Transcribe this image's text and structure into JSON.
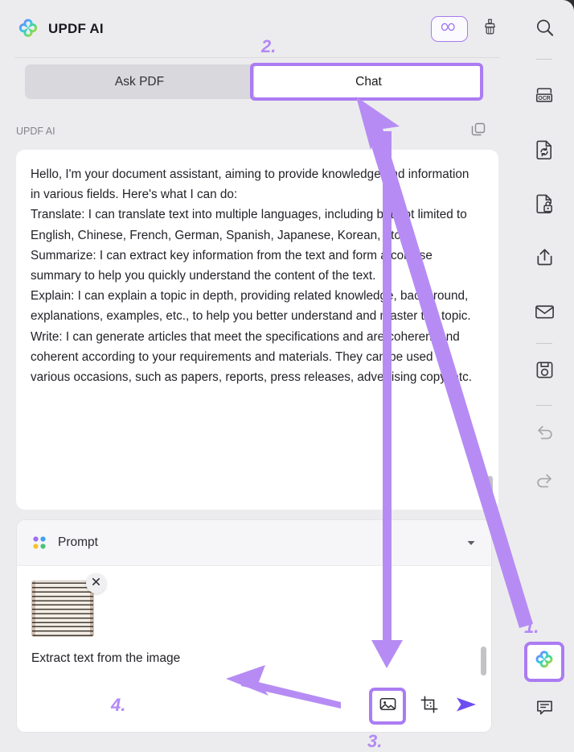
{
  "app": {
    "brand_name": "UPDF AI",
    "logo_icon": "updf-clover-logo"
  },
  "header": {
    "credits_icon": "infinity-icon",
    "brush_icon": "brush-icon"
  },
  "tabs": [
    {
      "label": "Ask PDF",
      "active": false
    },
    {
      "label": "Chat",
      "active": true
    }
  ],
  "message": {
    "sender": "UPDF AI",
    "copy_icon": "copy-icon",
    "paragraphs": [
      "Hello, I'm your document assistant, aiming to provide knowledge and information in various fields. Here's what I can do:",
      "Translate: I can translate text into multiple languages, including but not limited to English, Chinese, French, German, Spanish, Japanese, Korean, etc.",
      "Summarize: I can extract key information from the text and form a concise summary to help you quickly understand the content of the text.",
      "Explain: I can explain a topic in depth, providing related knowledge, background, explanations, examples, etc., to help you better understand and master the topic.",
      "Write: I can generate articles that meet the specifications and are coherent and coherent according to your requirements and materials. They can be used in various occasions, such as papers, reports, press releases, advertising copy, etc."
    ]
  },
  "prompt": {
    "title": "Prompt",
    "dots_icon": "four-dots-icon",
    "caret_icon": "chevron-down-icon",
    "attachment": {
      "thumbnail_alt": "handwritten-manuscript-thumbnail",
      "remove_icon": "close-icon"
    },
    "input_value": "Extract text from the image",
    "toolbar": {
      "image_icon": "image-icon",
      "crop_icon": "crop-scan-icon",
      "send_icon": "send-arrow-icon"
    }
  },
  "rail": {
    "items": [
      {
        "name": "search",
        "icon": "search-icon",
        "state": "normal"
      },
      {
        "name": "separator-1",
        "icon": "separator",
        "state": "separator"
      },
      {
        "name": "ocr",
        "icon": "ocr-icon",
        "state": "normal"
      },
      {
        "name": "convert",
        "icon": "convert-document-icon",
        "state": "normal"
      },
      {
        "name": "protect",
        "icon": "document-lock-icon",
        "state": "normal"
      },
      {
        "name": "share",
        "icon": "share-upload-icon",
        "state": "normal"
      },
      {
        "name": "email",
        "icon": "mail-envelope-icon",
        "state": "normal"
      },
      {
        "name": "separator-2",
        "icon": "separator",
        "state": "separator"
      },
      {
        "name": "save",
        "icon": "save-disk-icon",
        "state": "normal"
      },
      {
        "name": "separator-3",
        "icon": "separator",
        "state": "separator"
      },
      {
        "name": "undo",
        "icon": "undo-icon",
        "state": "disabled"
      },
      {
        "name": "redo",
        "icon": "redo-icon",
        "state": "disabled"
      },
      {
        "name": "updf-ai",
        "icon": "updf-clover-logo",
        "state": "highlighted"
      },
      {
        "name": "comment",
        "icon": "comment-bubble-icon",
        "state": "normal"
      }
    ]
  },
  "annotations": {
    "accent_color": "#ab7cf2",
    "steps": [
      {
        "id": "num1",
        "label": "1."
      },
      {
        "id": "num2",
        "label": "2."
      },
      {
        "id": "num3",
        "label": "3."
      },
      {
        "id": "num4",
        "label": "4."
      }
    ]
  }
}
